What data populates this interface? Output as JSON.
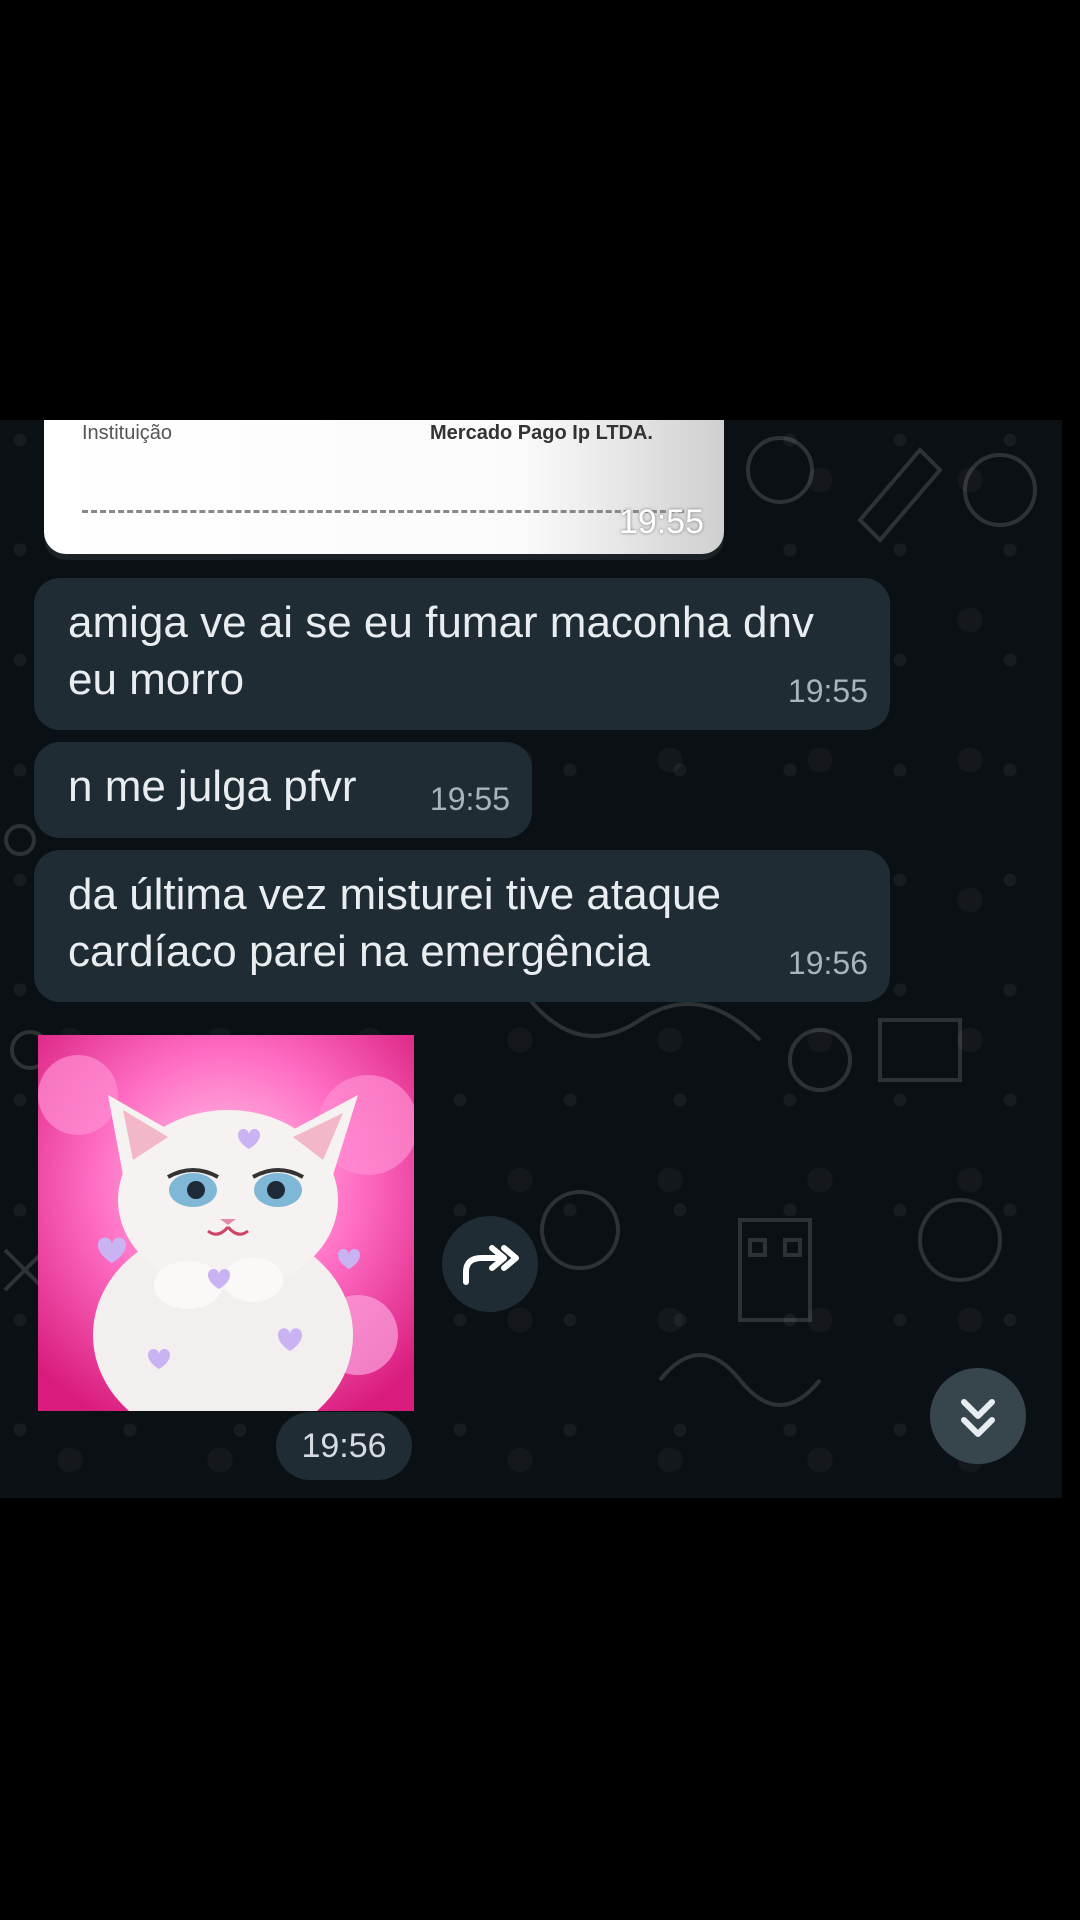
{
  "receipt": {
    "institution_label": "Instituição",
    "institution_value": "Mercado Pago Ip LTDA.",
    "time": "19:55"
  },
  "messages": [
    {
      "text": "amiga ve ai se eu fumar maconha dnv eu morro",
      "time": "19:55"
    },
    {
      "text": "n me julga pfvr",
      "time": "19:55"
    },
    {
      "text": "da última vez misturei tive ataque cardíaco parei na emergência",
      "time": "19:56"
    }
  ],
  "media_message": {
    "type": "sticker-image",
    "time": "19:56"
  },
  "icons": {
    "forward": "forward-icon",
    "scroll_down": "double-chevron-down-icon"
  },
  "colors": {
    "bubble": "#1f2c34",
    "chat_background": "#0b1014",
    "page_background": "#000000"
  }
}
